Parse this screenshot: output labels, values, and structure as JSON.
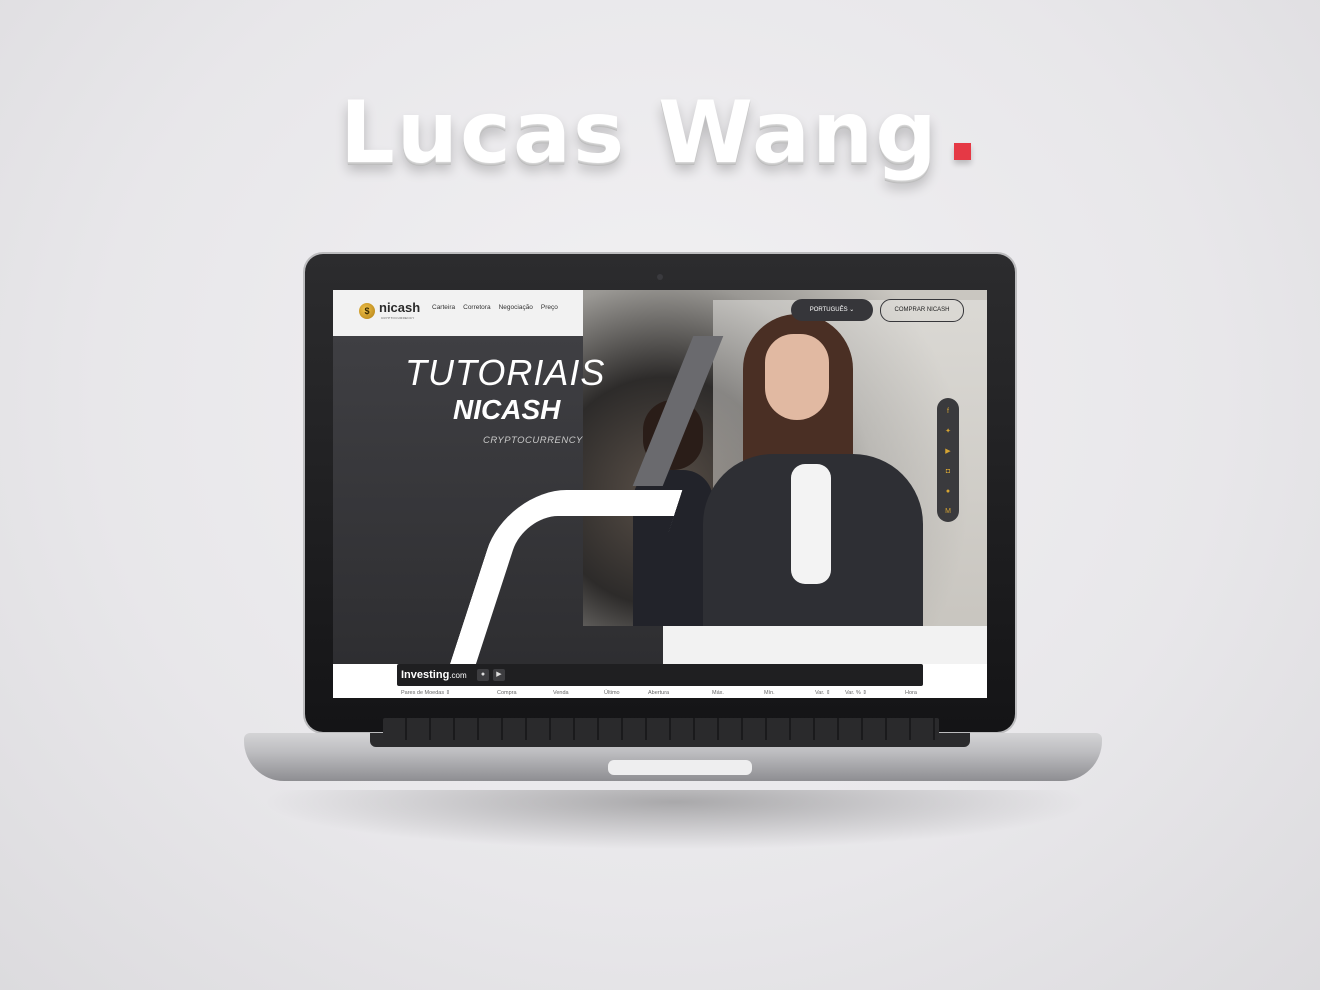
{
  "mockup": {
    "title": "Lucas Wang",
    "accent_color": "#e53945"
  },
  "site": {
    "logo": {
      "icon": "coin-icon",
      "text": "nicash",
      "subtitle": "CRYPTOCURRENCY"
    },
    "nav": {
      "links": [
        "Carteira",
        "Corretora",
        "Negociação",
        "Preço"
      ]
    },
    "language_button": "PORTUGUÊS ⌄",
    "buy_button": "COMPRAR NICASH",
    "hero": {
      "line1": "TUTORIAIS",
      "line2": "NICASH",
      "line3": "CRYPTOCURRENCY"
    },
    "social_icons": [
      "facebook-icon",
      "twitter-icon",
      "youtube-icon",
      "instagram-icon",
      "reddit-icon",
      "medium-icon"
    ],
    "widget": {
      "brand": "Investing",
      "brand_suffix": ".com",
      "columns": [
        "Pares de Moedas ⇕",
        "Compra",
        "Venda",
        "Último",
        "Abertura",
        "Máx.",
        "Mín.",
        "Var. ⇕",
        "Var. % ⇕",
        "Hora"
      ]
    }
  }
}
